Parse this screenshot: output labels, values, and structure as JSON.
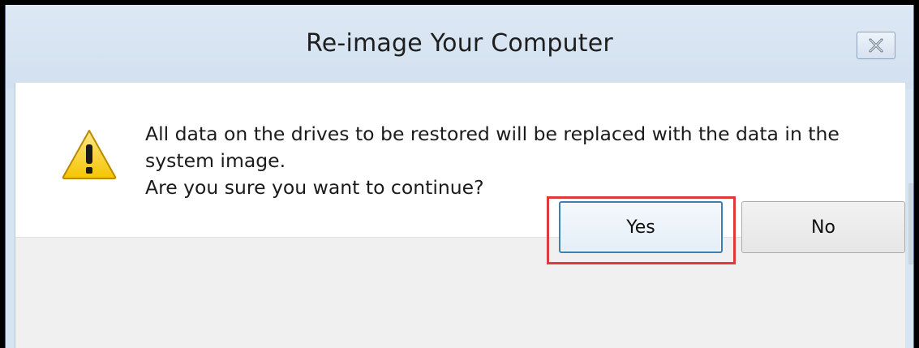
{
  "dialog": {
    "title": "Re-image Your Computer",
    "close_icon": "close-icon",
    "warning_icon": "warning-triangle-icon",
    "message_line1": "All data on the drives to be restored will be replaced with the data in the",
    "message_line2": "system image.",
    "message_line3": "Are you sure you want to continue?",
    "buttons": {
      "yes_label": "Yes",
      "no_label": "No"
    },
    "highlight_color": "#e0393c",
    "accent_color": "#3c7fb1"
  }
}
